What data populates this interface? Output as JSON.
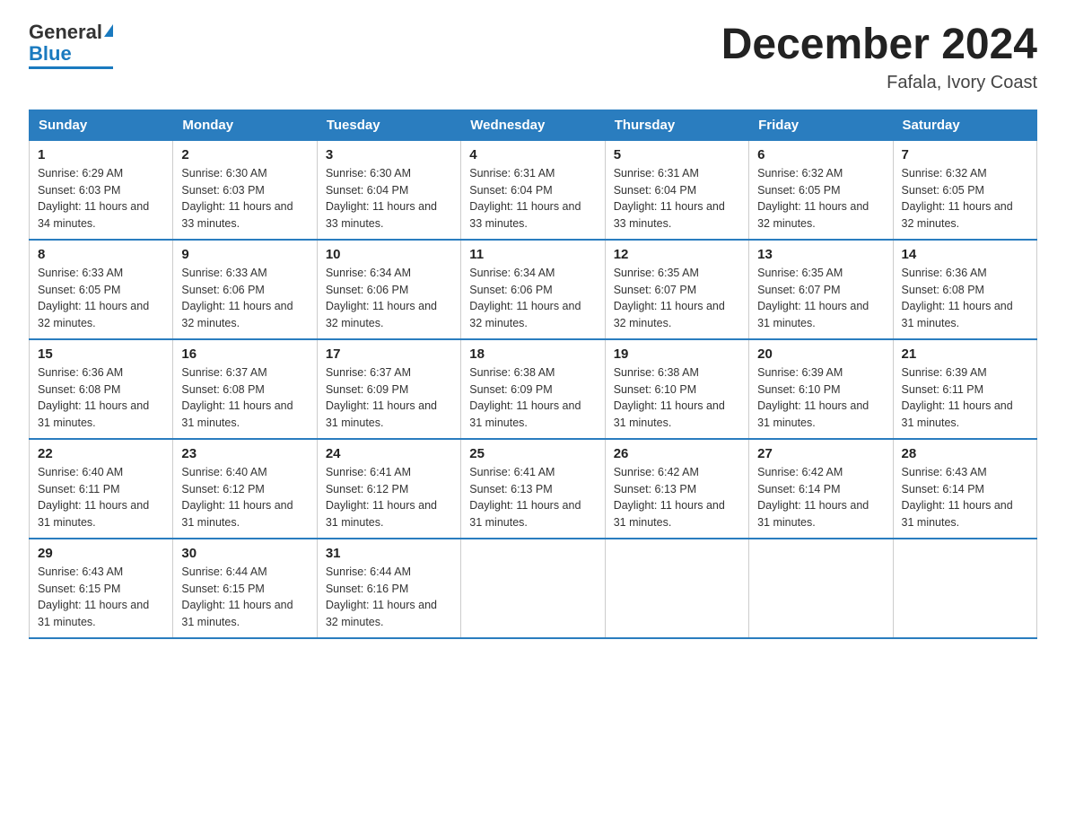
{
  "logo": {
    "general": "General",
    "blue": "Blue"
  },
  "title": {
    "month": "December 2024",
    "location": "Fafala, Ivory Coast"
  },
  "days_of_week": [
    "Sunday",
    "Monday",
    "Tuesday",
    "Wednesday",
    "Thursday",
    "Friday",
    "Saturday"
  ],
  "weeks": [
    [
      {
        "num": "1",
        "sunrise": "6:29 AM",
        "sunset": "6:03 PM",
        "daylight": "11 hours and 34 minutes."
      },
      {
        "num": "2",
        "sunrise": "6:30 AM",
        "sunset": "6:03 PM",
        "daylight": "11 hours and 33 minutes."
      },
      {
        "num": "3",
        "sunrise": "6:30 AM",
        "sunset": "6:04 PM",
        "daylight": "11 hours and 33 minutes."
      },
      {
        "num": "4",
        "sunrise": "6:31 AM",
        "sunset": "6:04 PM",
        "daylight": "11 hours and 33 minutes."
      },
      {
        "num": "5",
        "sunrise": "6:31 AM",
        "sunset": "6:04 PM",
        "daylight": "11 hours and 33 minutes."
      },
      {
        "num": "6",
        "sunrise": "6:32 AM",
        "sunset": "6:05 PM",
        "daylight": "11 hours and 32 minutes."
      },
      {
        "num": "7",
        "sunrise": "6:32 AM",
        "sunset": "6:05 PM",
        "daylight": "11 hours and 32 minutes."
      }
    ],
    [
      {
        "num": "8",
        "sunrise": "6:33 AM",
        "sunset": "6:05 PM",
        "daylight": "11 hours and 32 minutes."
      },
      {
        "num": "9",
        "sunrise": "6:33 AM",
        "sunset": "6:06 PM",
        "daylight": "11 hours and 32 minutes."
      },
      {
        "num": "10",
        "sunrise": "6:34 AM",
        "sunset": "6:06 PM",
        "daylight": "11 hours and 32 minutes."
      },
      {
        "num": "11",
        "sunrise": "6:34 AM",
        "sunset": "6:06 PM",
        "daylight": "11 hours and 32 minutes."
      },
      {
        "num": "12",
        "sunrise": "6:35 AM",
        "sunset": "6:07 PM",
        "daylight": "11 hours and 32 minutes."
      },
      {
        "num": "13",
        "sunrise": "6:35 AM",
        "sunset": "6:07 PM",
        "daylight": "11 hours and 31 minutes."
      },
      {
        "num": "14",
        "sunrise": "6:36 AM",
        "sunset": "6:08 PM",
        "daylight": "11 hours and 31 minutes."
      }
    ],
    [
      {
        "num": "15",
        "sunrise": "6:36 AM",
        "sunset": "6:08 PM",
        "daylight": "11 hours and 31 minutes."
      },
      {
        "num": "16",
        "sunrise": "6:37 AM",
        "sunset": "6:08 PM",
        "daylight": "11 hours and 31 minutes."
      },
      {
        "num": "17",
        "sunrise": "6:37 AM",
        "sunset": "6:09 PM",
        "daylight": "11 hours and 31 minutes."
      },
      {
        "num": "18",
        "sunrise": "6:38 AM",
        "sunset": "6:09 PM",
        "daylight": "11 hours and 31 minutes."
      },
      {
        "num": "19",
        "sunrise": "6:38 AM",
        "sunset": "6:10 PM",
        "daylight": "11 hours and 31 minutes."
      },
      {
        "num": "20",
        "sunrise": "6:39 AM",
        "sunset": "6:10 PM",
        "daylight": "11 hours and 31 minutes."
      },
      {
        "num": "21",
        "sunrise": "6:39 AM",
        "sunset": "6:11 PM",
        "daylight": "11 hours and 31 minutes."
      }
    ],
    [
      {
        "num": "22",
        "sunrise": "6:40 AM",
        "sunset": "6:11 PM",
        "daylight": "11 hours and 31 minutes."
      },
      {
        "num": "23",
        "sunrise": "6:40 AM",
        "sunset": "6:12 PM",
        "daylight": "11 hours and 31 minutes."
      },
      {
        "num": "24",
        "sunrise": "6:41 AM",
        "sunset": "6:12 PM",
        "daylight": "11 hours and 31 minutes."
      },
      {
        "num": "25",
        "sunrise": "6:41 AM",
        "sunset": "6:13 PM",
        "daylight": "11 hours and 31 minutes."
      },
      {
        "num": "26",
        "sunrise": "6:42 AM",
        "sunset": "6:13 PM",
        "daylight": "11 hours and 31 minutes."
      },
      {
        "num": "27",
        "sunrise": "6:42 AM",
        "sunset": "6:14 PM",
        "daylight": "11 hours and 31 minutes."
      },
      {
        "num": "28",
        "sunrise": "6:43 AM",
        "sunset": "6:14 PM",
        "daylight": "11 hours and 31 minutes."
      }
    ],
    [
      {
        "num": "29",
        "sunrise": "6:43 AM",
        "sunset": "6:15 PM",
        "daylight": "11 hours and 31 minutes."
      },
      {
        "num": "30",
        "sunrise": "6:44 AM",
        "sunset": "6:15 PM",
        "daylight": "11 hours and 31 minutes."
      },
      {
        "num": "31",
        "sunrise": "6:44 AM",
        "sunset": "6:16 PM",
        "daylight": "11 hours and 32 minutes."
      },
      null,
      null,
      null,
      null
    ]
  ]
}
